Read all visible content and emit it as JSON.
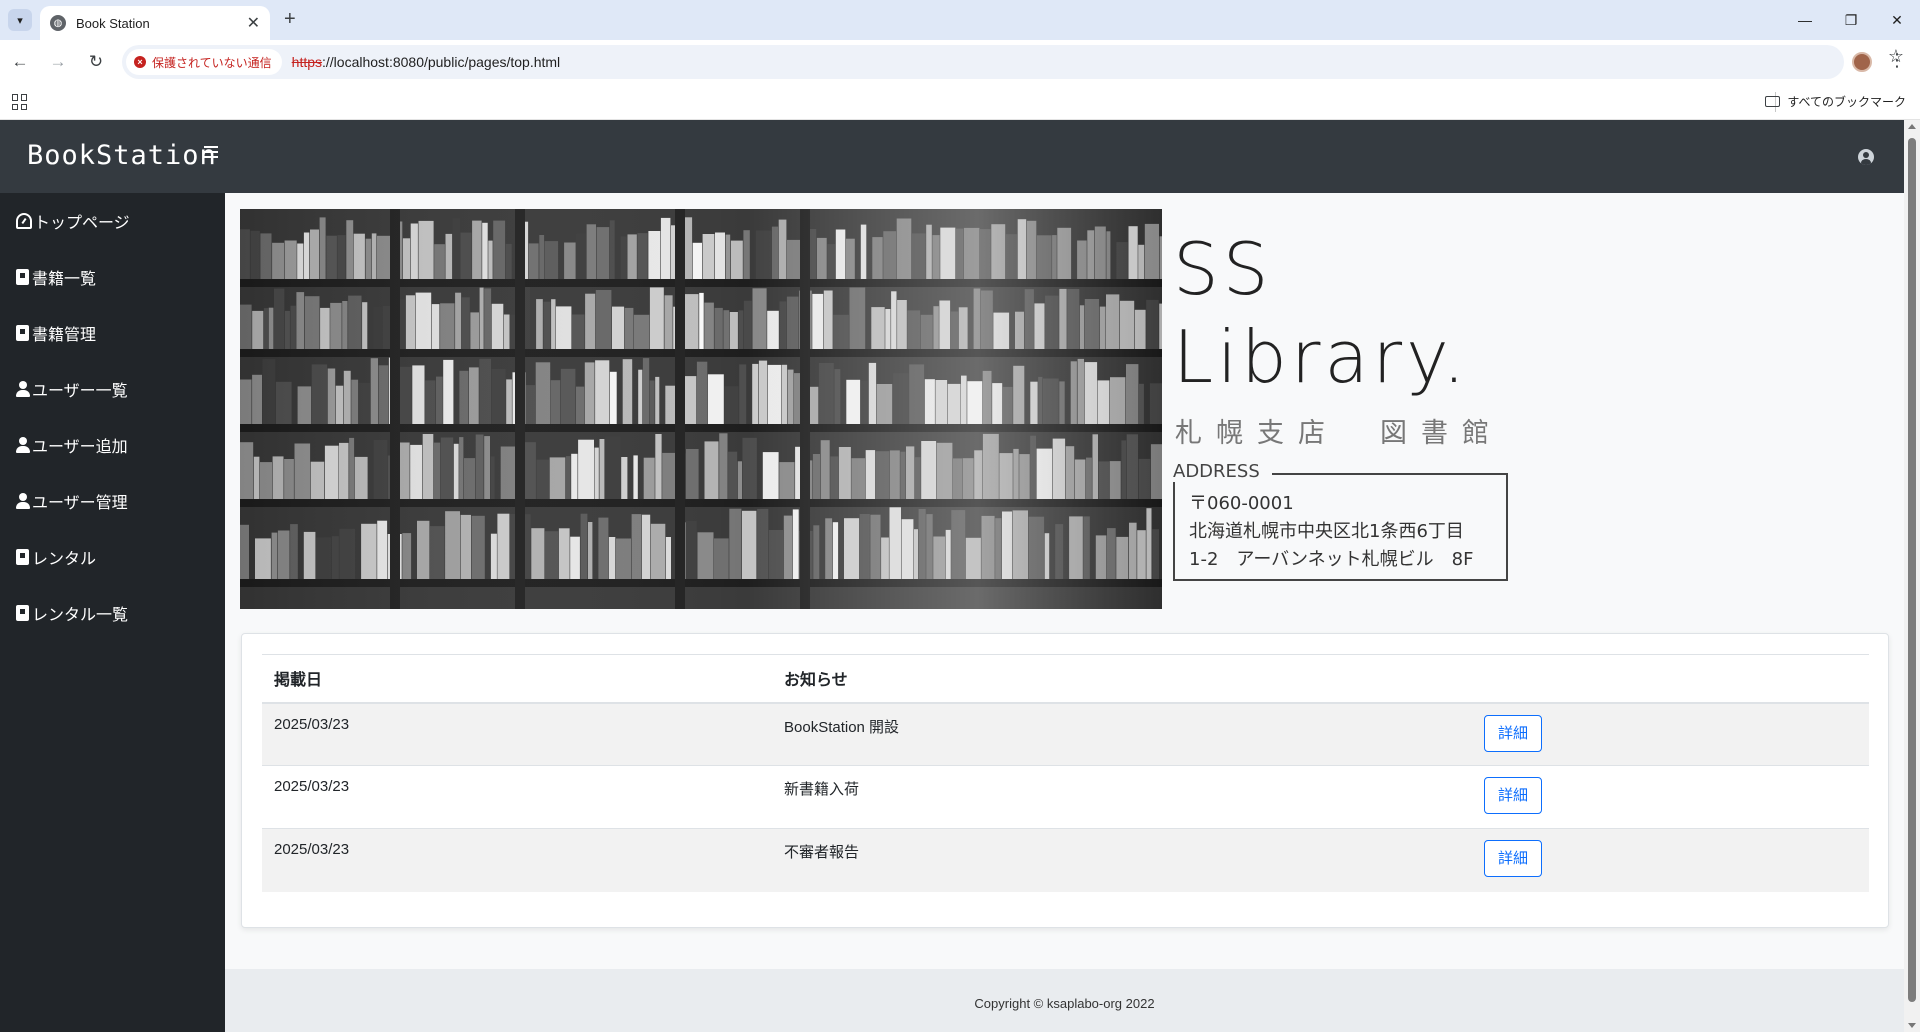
{
  "browser": {
    "tab_title": "Book Station",
    "security_label": "保護されていない通信",
    "url_scheme": "https",
    "url_rest": "://localhost:8080/public/pages/top.html",
    "bookmarks_all": "すべてのブックマーク"
  },
  "navbar": {
    "brand": "BookStation"
  },
  "sidebar": {
    "items": [
      {
        "label": "トップページ",
        "icon": "dashboard-icon"
      },
      {
        "label": "書籍一覧",
        "icon": "book-icon"
      },
      {
        "label": "書籍管理",
        "icon": "book-icon"
      },
      {
        "label": "ユーザー一覧",
        "icon": "user-icon"
      },
      {
        "label": "ユーザー追加",
        "icon": "user-icon"
      },
      {
        "label": "ユーザー管理",
        "icon": "user-icon"
      },
      {
        "label": "レンタル",
        "icon": "book-icon"
      },
      {
        "label": "レンタル一覧",
        "icon": "book-icon"
      }
    ]
  },
  "hero": {
    "line1": "SS",
    "line2": "Library.",
    "subtitle": "札幌支店　図書館",
    "address_title": "ADDRESS",
    "address_lines": [
      "〒060-0001",
      "北海道札幌市中央区北1条西6丁目",
      "1-2　アーバンネット札幌ビル　8F"
    ]
  },
  "news": {
    "headers": [
      "掲載日",
      "お知らせ",
      ""
    ],
    "rows": [
      {
        "date": "2025/03/23",
        "title": "BookStation 開設",
        "button": "詳細"
      },
      {
        "date": "2025/03/23",
        "title": "新書籍入荷",
        "button": "詳細"
      },
      {
        "date": "2025/03/23",
        "title": "不審者報告",
        "button": "詳細"
      }
    ]
  },
  "footer": {
    "text": "Copyright © ksaplabo-org 2022"
  },
  "colors": {
    "navbar": "#343a40",
    "sidebar": "#212529",
    "accent": "#0d6efd",
    "insecure": "#c5221f"
  }
}
